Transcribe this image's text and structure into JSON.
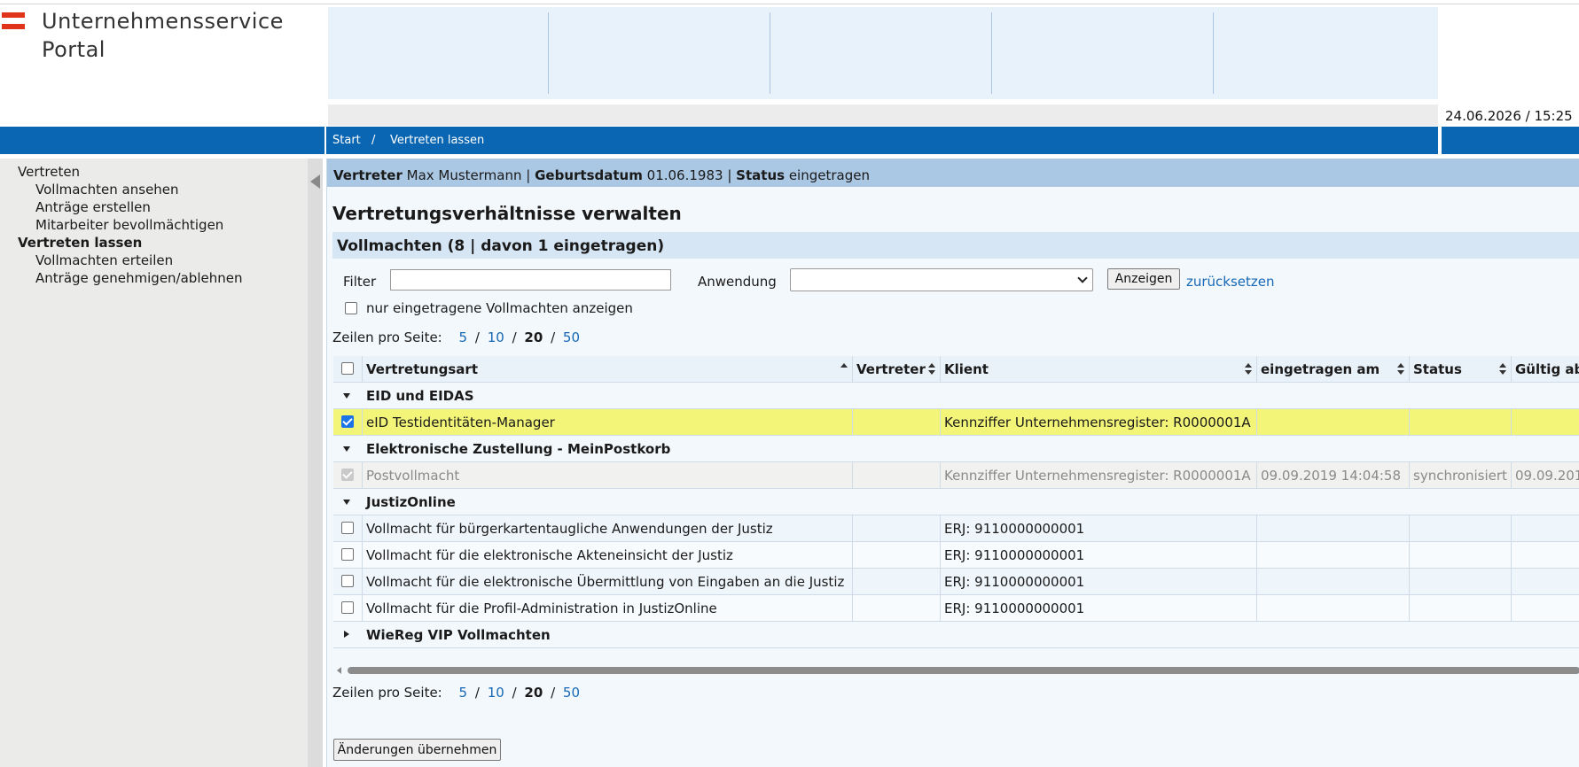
{
  "header": {
    "logo_line1": "Unternehmensservice",
    "logo_line2": "Portal",
    "datetime": "24.06.2026 / 15:25"
  },
  "breadcrumb": {
    "start": "Start",
    "separator": "/",
    "current": "Vertreten lassen"
  },
  "sidebar": {
    "items": [
      {
        "label": "Vertreten",
        "level": 1,
        "active": false
      },
      {
        "label": "Vollmachten ansehen",
        "level": 2,
        "active": false
      },
      {
        "label": "Anträge erstellen",
        "level": 2,
        "active": false
      },
      {
        "label": "Mitarbeiter bevollmächtigen",
        "level": 2,
        "active": false
      },
      {
        "label": "Vertreten lassen",
        "level": 1,
        "active": true
      },
      {
        "label": "Vollmachten erteilen",
        "level": 2,
        "active": false
      },
      {
        "label": "Anträge genehmigen/ablehnen",
        "level": 2,
        "active": false
      }
    ]
  },
  "userbar": {
    "vertreter_label": "Vertreter",
    "vertreter_value": "Max Mustermann",
    "sep": "|",
    "geburtsdatum_label": "Geburtsdatum",
    "geburtsdatum_value": "01.06.1983",
    "status_label": "Status",
    "status_value": "eingetragen"
  },
  "main": {
    "title": "Vertretungsverhältnisse verwalten",
    "section": "Vollmachten (8 | davon 1 eingetragen)"
  },
  "filters": {
    "filter_label": "Filter",
    "filter_value": "",
    "anwendung_label": "Anwendung",
    "anwendung_value": "",
    "anzeigen_button": "Anzeigen",
    "reset_link": "zurücksetzen",
    "only_registered_label": "nur eingetragene Vollmachten anzeigen",
    "only_registered_checked": false
  },
  "pager": {
    "label": "Zeilen pro Seite:",
    "options": [
      "5",
      "10",
      "20",
      "50"
    ],
    "separator": "/",
    "current": "20"
  },
  "table": {
    "columns": [
      "Vertretungsart",
      "Vertreter",
      "Klient",
      "eingetragen am",
      "Status",
      "Gültig ab"
    ],
    "groups": [
      {
        "name": "EID und EIDAS",
        "expanded": true,
        "rows": [
          {
            "checked": true,
            "disabled": false,
            "selected": true,
            "vertretungsart": "eID Testidentitäten-Manager",
            "vertreter": "",
            "klient": "Kennziffer Unternehmensregister: R0000001A",
            "eingetragen_am": "",
            "status": "",
            "gueltig_ab": ""
          }
        ]
      },
      {
        "name": "Elektronische Zustellung - MeinPostkorb",
        "expanded": true,
        "rows": [
          {
            "checked": true,
            "disabled": true,
            "selected": false,
            "vertretungsart": "Postvollmacht",
            "vertreter": "",
            "klient": "Kennziffer Unternehmensregister: R0000001A",
            "eingetragen_am": "09.09.2019 14:04:58",
            "status": "synchronisiert",
            "gueltig_ab": "09.09.201"
          }
        ]
      },
      {
        "name": "JustizOnline",
        "expanded": true,
        "rows": [
          {
            "checked": false,
            "disabled": false,
            "selected": false,
            "vertretungsart": "Vollmacht für bürgerkartentaugliche Anwendungen der Justiz",
            "vertreter": "",
            "klient": "ERJ: 9110000000001",
            "eingetragen_am": "",
            "status": "",
            "gueltig_ab": ""
          },
          {
            "checked": false,
            "disabled": false,
            "selected": false,
            "vertretungsart": "Vollmacht für die elektronische Akteneinsicht der Justiz",
            "vertreter": "",
            "klient": "ERJ: 9110000000001",
            "eingetragen_am": "",
            "status": "",
            "gueltig_ab": ""
          },
          {
            "checked": false,
            "disabled": false,
            "selected": false,
            "vertretungsart": "Vollmacht für die elektronische Übermittlung von Eingaben an die Justiz",
            "vertreter": "",
            "klient": "ERJ: 9110000000001",
            "eingetragen_am": "",
            "status": "",
            "gueltig_ab": ""
          },
          {
            "checked": false,
            "disabled": false,
            "selected": false,
            "vertretungsart": "Vollmacht für die Profil-Administration in JustizOnline",
            "vertreter": "",
            "klient": "ERJ: 9110000000001",
            "eingetragen_am": "",
            "status": "",
            "gueltig_ab": ""
          }
        ]
      },
      {
        "name": "WieReg VIP Vollmachten",
        "expanded": false,
        "rows": []
      }
    ]
  },
  "actions": {
    "save_button": "Änderungen übernehmen"
  },
  "colors": {
    "brand_blue": "#0a66b2",
    "flag_red": "#e0341a",
    "selected_row": "#f3f578",
    "link": "#1668b5"
  }
}
